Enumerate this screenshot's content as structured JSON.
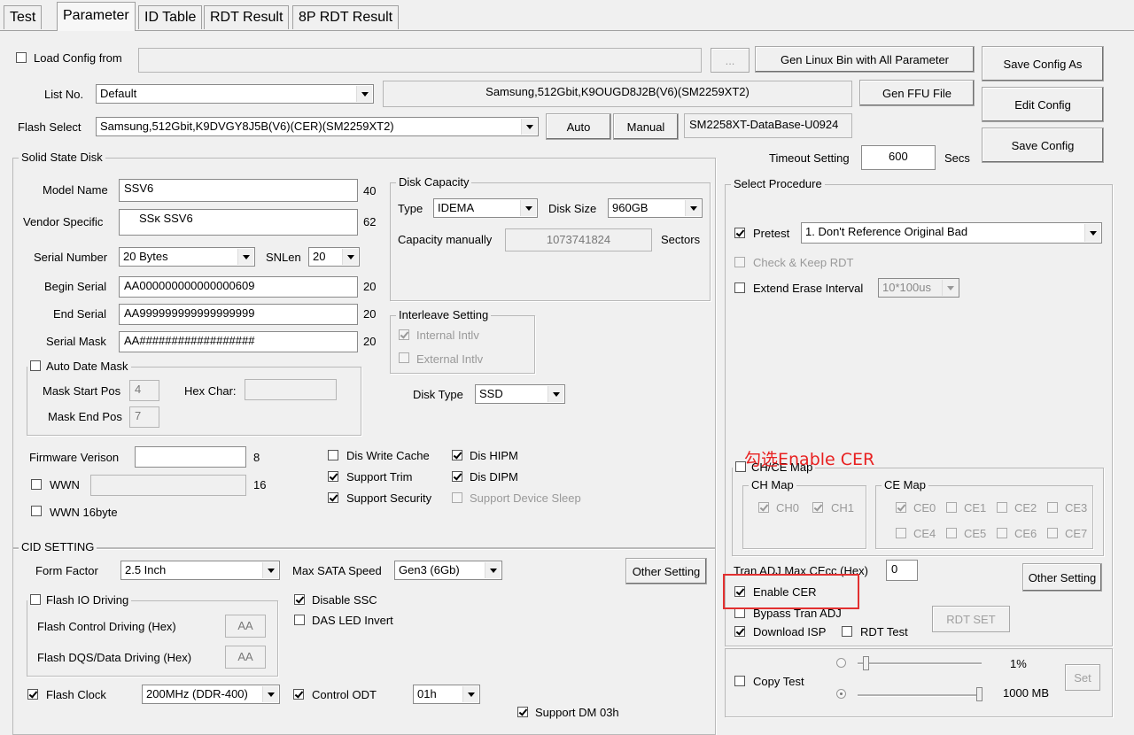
{
  "tabs": [
    "Test",
    "Parameter",
    "ID Table",
    "RDT Result",
    "8P RDT Result"
  ],
  "top": {
    "load_config_label": "Load Config from",
    "load_config_value": "",
    "browse_label": "...",
    "gen_linux_label": "Gen Linux Bin with All Parameter",
    "save_config_as_label": "Save Config As",
    "list_no_label": "List No.",
    "list_no_value": "Default",
    "list_no_desc": "Samsung,512Gbit,K9OUGD8J2B(V6)(SM2259XT2)",
    "gen_ffu_label": "Gen FFU File",
    "edit_config_label": "Edit Config",
    "flash_select_label": "Flash Select",
    "flash_select_value": "Samsung,512Gbit,K9DVGY8J5B(V6)(CER)(SM2259XT2)",
    "auto_label": "Auto",
    "manual_label": "Manual",
    "database_value": "SM2258XT-DataBase-U0924",
    "save_config_label": "Save Config",
    "timeout_label": "Timeout Setting",
    "timeout_value": "600",
    "secs_label": "Secs"
  },
  "ssd": {
    "title": "Solid State Disk",
    "model_name_label": "Model Name",
    "model_name_value": "SSV6",
    "model_name_len": "40",
    "vendor_label": "Vendor Specific",
    "vendor_value": "SSκ SSV6",
    "vendor_len": "62",
    "serial_number_label": "Serial Number",
    "serial_number_value": "20 Bytes",
    "snlen_label": "SNLen",
    "snlen_value": "20",
    "begin_serial_label": "Begin Serial",
    "begin_serial_value": "AA000000000000000609",
    "begin_serial_len": "20",
    "end_serial_label": "End Serial",
    "end_serial_value": "AA999999999999999999",
    "end_serial_len": "20",
    "serial_mask_label": "Serial Mask",
    "serial_mask_value": "AA##################",
    "serial_mask_len": "20",
    "auto_date_mask_label": "Auto Date Mask",
    "mask_start_label": "Mask Start Pos",
    "mask_start_value": "4",
    "hex_char_label": "Hex Char:",
    "hex_char_value": "",
    "mask_end_label": "Mask End Pos",
    "mask_end_value": "7",
    "disk_capacity_title": "Disk Capacity",
    "type_label": "Type",
    "type_value": "IDEMA",
    "disk_size_label": "Disk Size",
    "disk_size_value": "960GB",
    "capacity_manually_label": "Capacity manually",
    "capacity_value": "1073741824",
    "sectors_label": "Sectors",
    "interleave_title": "Interleave Setting",
    "internal_intlv_label": "Internal Intlv",
    "external_intlv_label": "External Intlv",
    "disk_type_label": "Disk Type",
    "disk_type_value": "SSD",
    "firmware_label": "Firmware Verison",
    "firmware_value": "",
    "firmware_len": "8",
    "wwn_label": "WWN",
    "wwn_value": "",
    "wwn_len": "16",
    "wwn16_label": "WWN 16byte",
    "dis_write_cache_label": "Dis Write Cache",
    "dis_hipm_label": "Dis HIPM",
    "support_trim_label": "Support Trim",
    "dis_dipm_label": "Dis DIPM",
    "support_security_label": "Support Security",
    "support_device_sleep_label": "Support Device Sleep"
  },
  "cid": {
    "title": "CID SETTING",
    "form_factor_label": "Form Factor",
    "form_factor_value": "2.5 Inch",
    "max_sata_label": "Max SATA Speed",
    "max_sata_value": "Gen3 (6Gb)",
    "other_setting_label": "Other Setting",
    "flash_io_label": "Flash IO Driving",
    "disable_ssc_label": "Disable SSC",
    "das_led_label": "DAS LED Invert",
    "flash_control_label": "Flash Control Driving (Hex)",
    "flash_control_value": "AA",
    "flash_dqs_label": "Flash DQS/Data Driving (Hex)",
    "flash_dqs_value": "AA",
    "flash_clock_label": "Flash Clock",
    "flash_clock_value": "200MHz (DDR-400)",
    "control_odt_label": "Control ODT",
    "control_odt_value": "01h",
    "support_dm_label": "Support DM 03h"
  },
  "procedure": {
    "title": "Select Procedure",
    "pretest_label": "Pretest",
    "pretest_value": "1. Don't Reference Original Bad",
    "check_keep_rdt_label": "Check & Keep RDT",
    "extend_erase_label": "Extend Erase Interval",
    "extend_erase_value": "10*100us",
    "chce_map_label": "CH/CE Map",
    "ch_map_title": "CH Map",
    "ce_map_title": "CE Map",
    "ch": [
      "CH0",
      "CH1"
    ],
    "ce": [
      "CE0",
      "CE1",
      "CE2",
      "CE3",
      "CE4",
      "CE5",
      "CE6",
      "CE7"
    ],
    "tran_adj_label": "Tran ADJ Max CEcc (Hex)",
    "tran_adj_value": "0",
    "other_setting_label": "Other Setting",
    "enable_cer_label": "Enable CER",
    "bypass_tran_label": "Bypass Tran ADJ",
    "rdt_set_label": "RDT SET",
    "download_isp_label": "Download ISP",
    "rdt_test_label": "RDT Test",
    "copy_test_label": "Copy Test",
    "percent_value": "1%",
    "mb_value": "1000 MB",
    "set_label": "Set"
  },
  "annotation": {
    "text": "勾选Enable CER",
    "color": "#e82020"
  }
}
